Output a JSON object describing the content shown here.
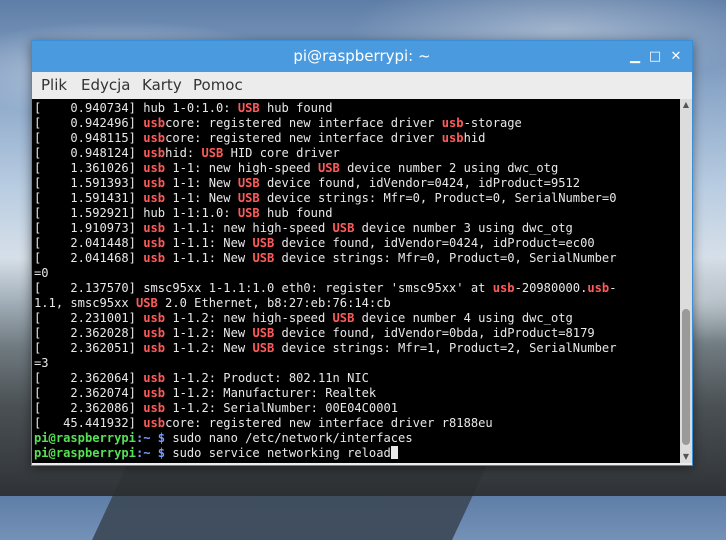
{
  "window": {
    "title": "pi@raspberrypi: ~",
    "minimize_glyph": "▁",
    "maximize_glyph": "□",
    "close_glyph": "✕"
  },
  "menu": {
    "file": "Plik",
    "edit": "Edycja",
    "tabs": "Karty",
    "help": "Pomoc"
  },
  "colors": {
    "titlebar": "#4a9ae0",
    "highlight": "#ff5a5a",
    "prompt_user": "#55e055",
    "prompt_path": "#7a9cff"
  },
  "terminal": {
    "lines": [
      [
        {
          "t": "[    0.940734] hub 1-0:1.0: "
        },
        {
          "t": "USB",
          "h": 1
        },
        {
          "t": " hub found"
        }
      ],
      [
        {
          "t": "[    0.942496] "
        },
        {
          "t": "usb",
          "h": 1
        },
        {
          "t": "core: registered new interface driver "
        },
        {
          "t": "usb",
          "h": 1
        },
        {
          "t": "-storage"
        }
      ],
      [
        {
          "t": "[    0.948115] "
        },
        {
          "t": "usb",
          "h": 1
        },
        {
          "t": "core: registered new interface driver "
        },
        {
          "t": "usb",
          "h": 1
        },
        {
          "t": "hid"
        }
      ],
      [
        {
          "t": "[    0.948124] "
        },
        {
          "t": "usb",
          "h": 1
        },
        {
          "t": "hid: "
        },
        {
          "t": "USB",
          "h": 1
        },
        {
          "t": " HID core driver"
        }
      ],
      [
        {
          "t": "[    1.361026] "
        },
        {
          "t": "usb",
          "h": 1
        },
        {
          "t": " 1-1: new high-speed "
        },
        {
          "t": "USB",
          "h": 1
        },
        {
          "t": " device number 2 using dwc_otg"
        }
      ],
      [
        {
          "t": "[    1.591393] "
        },
        {
          "t": "usb",
          "h": 1
        },
        {
          "t": " 1-1: New "
        },
        {
          "t": "USB",
          "h": 1
        },
        {
          "t": " device found, idVendor=0424, idProduct=9512"
        }
      ],
      [
        {
          "t": "[    1.591431] "
        },
        {
          "t": "usb",
          "h": 1
        },
        {
          "t": " 1-1: New "
        },
        {
          "t": "USB",
          "h": 1
        },
        {
          "t": " device strings: Mfr=0, Product=0, SerialNumber=0"
        }
      ],
      [
        {
          "t": "[    1.592921] hub 1-1:1.0: "
        },
        {
          "t": "USB",
          "h": 1
        },
        {
          "t": " hub found"
        }
      ],
      [
        {
          "t": "[    1.910973] "
        },
        {
          "t": "usb",
          "h": 1
        },
        {
          "t": " 1-1.1: new high-speed "
        },
        {
          "t": "USB",
          "h": 1
        },
        {
          "t": " device number 3 using dwc_otg"
        }
      ],
      [
        {
          "t": "[    2.041448] "
        },
        {
          "t": "usb",
          "h": 1
        },
        {
          "t": " 1-1.1: New "
        },
        {
          "t": "USB",
          "h": 1
        },
        {
          "t": " device found, idVendor=0424, idProduct=ec00"
        }
      ],
      [
        {
          "t": "[    2.041468] "
        },
        {
          "t": "usb",
          "h": 1
        },
        {
          "t": " 1-1.1: New "
        },
        {
          "t": "USB",
          "h": 1
        },
        {
          "t": " device strings: Mfr=0, Product=0, SerialNumber"
        }
      ],
      [
        {
          "t": "=0"
        }
      ],
      [
        {
          "t": "[    2.137570] smsc95xx 1-1.1:1.0 eth0: register 'smsc95xx' at "
        },
        {
          "t": "usb",
          "h": 1
        },
        {
          "t": "-20980000."
        },
        {
          "t": "usb",
          "h": 1
        },
        {
          "t": "-"
        }
      ],
      [
        {
          "t": "1.1, smsc95xx "
        },
        {
          "t": "USB",
          "h": 1
        },
        {
          "t": " 2.0 Ethernet, b8:27:eb:76:14:cb"
        }
      ],
      [
        {
          "t": "[    2.231001] "
        },
        {
          "t": "usb",
          "h": 1
        },
        {
          "t": " 1-1.2: new high-speed "
        },
        {
          "t": "USB",
          "h": 1
        },
        {
          "t": " device number 4 using dwc_otg"
        }
      ],
      [
        {
          "t": "[    2.362028] "
        },
        {
          "t": "usb",
          "h": 1
        },
        {
          "t": " 1-1.2: New "
        },
        {
          "t": "USB",
          "h": 1
        },
        {
          "t": " device found, idVendor=0bda, idProduct=8179"
        }
      ],
      [
        {
          "t": "[    2.362051] "
        },
        {
          "t": "usb",
          "h": 1
        },
        {
          "t": " 1-1.2: New "
        },
        {
          "t": "USB",
          "h": 1
        },
        {
          "t": " device strings: Mfr=1, Product=2, SerialNumber"
        }
      ],
      [
        {
          "t": "=3"
        }
      ],
      [
        {
          "t": "[    2.362064] "
        },
        {
          "t": "usb",
          "h": 1
        },
        {
          "t": " 1-1.2: Product: 802.11n NIC"
        }
      ],
      [
        {
          "t": "[    2.362074] "
        },
        {
          "t": "usb",
          "h": 1
        },
        {
          "t": " 1-1.2: Manufacturer: Realtek"
        }
      ],
      [
        {
          "t": "[    2.362086] "
        },
        {
          "t": "usb",
          "h": 1
        },
        {
          "t": " 1-1.2: SerialNumber: 00E04C0001"
        }
      ],
      [
        {
          "t": "[   45.441932] "
        },
        {
          "t": "usb",
          "h": 1
        },
        {
          "t": "core: registered new interface driver r8188eu"
        }
      ]
    ],
    "prompt_user": "pi@raspberrypi",
    "prompt_path": ":~ $",
    "commands": [
      "sudo nano /etc/network/interfaces",
      "sudo service networking reload"
    ]
  },
  "scrollbar": {
    "up_glyph": "▲",
    "down_glyph": "▼"
  }
}
